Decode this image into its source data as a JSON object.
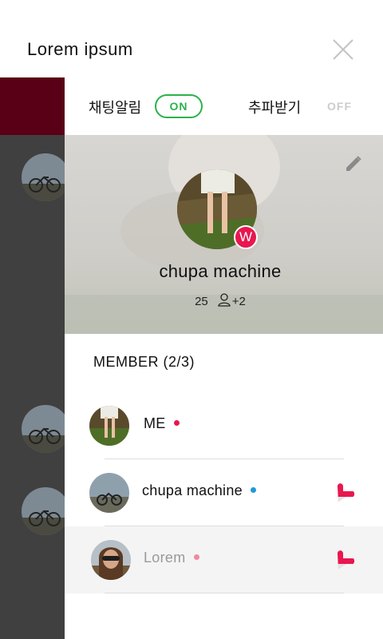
{
  "header": {
    "title": "Lorem ipsum"
  },
  "settings": {
    "chat_alert_label": "채팅알림",
    "chat_alert_state": "ON",
    "kick_label": "추파받기",
    "kick_state": "OFF"
  },
  "profile": {
    "name": "chupa machine",
    "badge": "W",
    "count": "25",
    "extra": "+2"
  },
  "members": {
    "header": "MEMBER (2/3)",
    "list": [
      {
        "name": "ME",
        "status_color": "#e8174f"
      },
      {
        "name": "chupa machine",
        "status_color": "#1e9ad6"
      },
      {
        "name": "Lorem",
        "status_color": "#f08aa0"
      }
    ]
  },
  "colors": {
    "accent_green": "#2bb24c",
    "badge_red": "#e8174f",
    "underlay_dark": "#404040",
    "underlay_maroon": "#5a0016"
  },
  "icons": [
    "close-icon",
    "edit-pencil-icon",
    "person-icon",
    "kick-heart-icon"
  ]
}
